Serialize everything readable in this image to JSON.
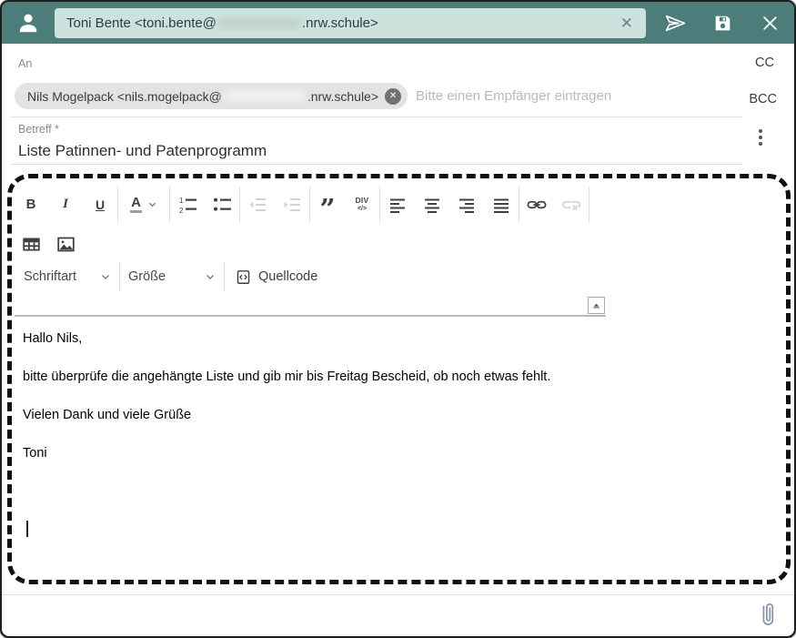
{
  "colors": {
    "topbar-bg": "#4d7d7a",
    "sender-field-bg": "#cde2dc",
    "icon": "#3f3f3f",
    "icon-disabled": "#d3d3d3",
    "divider": "#dedede",
    "label": "#8b8b8b",
    "placeholder": "#b9b9b9",
    "chip-bg": "#e3e3e3",
    "chip-remove-bg": "#717171",
    "highlight-border": "#101010"
  },
  "topbar": {
    "sender_prefix": "Toni Bente <toni.bente@",
    "sender_suffix": ".nrw.schule>",
    "clear_glyph": "✕",
    "chip_remove_glyph": "✕"
  },
  "recipients": {
    "to_label": "An",
    "chip_prefix": "Nils Mogelpack <nils.mogelpack@",
    "chip_suffix": ".nrw.schule>",
    "placeholder": "Bitte einen Empfänger eintragen",
    "cc_label": "CC",
    "bcc_label": "BCC"
  },
  "subject": {
    "label": "Betreff *",
    "value": "Liste Patinnen- und Patenprogramm"
  },
  "toolbar": {
    "bold": "B",
    "italic": "I",
    "underline": "U",
    "font_color": "A",
    "ol_digit1": "1",
    "ol_digit2": "2",
    "quote_glyph": "”",
    "div_label": "DIV",
    "div_code": "</>",
    "font_family_label": "Schriftart",
    "font_size_label": "Größe",
    "source_label": "Quellcode"
  },
  "body": {
    "paragraphs": [
      "Hallo Nils,",
      "bitte überprüfe die angehängte Liste und gib mir bis Freitag Bescheid, ob noch etwas fehlt.",
      "Vielen Dank und viele Grüße",
      "Toni"
    ]
  }
}
